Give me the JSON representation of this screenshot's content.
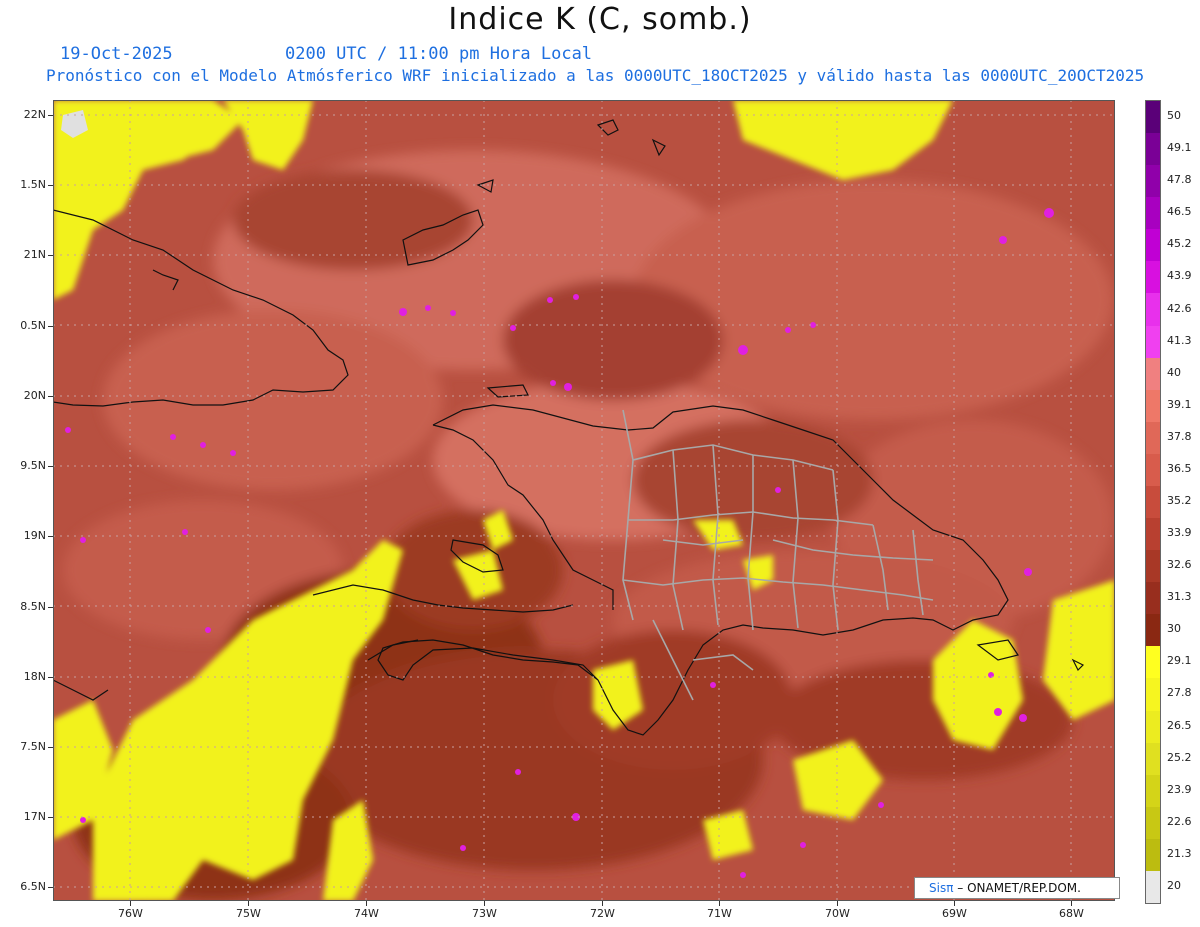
{
  "header": {
    "title": "Indice K (C, somb.)",
    "date": "19-Oct-2025",
    "time": "0200 UTC / 11:00 pm Hora Local",
    "forecast": "Pronóstico con el Modelo Atmósferico WRF inicializado a las 0000UTC_18OCT2025 y válido hasta las  0000UTC_20OCT2025"
  },
  "axes": {
    "lat_labels": [
      "22N",
      "1.5N",
      "21N",
      "0.5N",
      "20N",
      "9.5N",
      "19N",
      "8.5N",
      "18N",
      "7.5N",
      "17N",
      "6.5N"
    ],
    "lon_labels": [
      "76W",
      "75W",
      "74W",
      "73W",
      "72W",
      "71W",
      "70W",
      "69W",
      "68W"
    ]
  },
  "colorbar": {
    "labels": [
      "50",
      "49.1",
      "47.8",
      "46.5",
      "45.2",
      "43.9",
      "42.6",
      "41.3",
      "40",
      "39.1",
      "37.8",
      "36.5",
      "35.2",
      "33.9",
      "32.6",
      "31.3",
      "30",
      "29.1",
      "27.8",
      "26.5",
      "25.2",
      "23.9",
      "22.6",
      "21.3",
      "20"
    ],
    "colors": [
      "#5a0078",
      "#7a0096",
      "#9000aa",
      "#a800c0",
      "#c000d4",
      "#d810e0",
      "#e830ec",
      "#f040f0",
      "#f08080",
      "#ee7868",
      "#e06858",
      "#d85c4c",
      "#c84c3c",
      "#b84030",
      "#a83826",
      "#982e1e",
      "#8a2812",
      "#ffff20",
      "#f6f520",
      "#ecec20",
      "#e0e020",
      "#d4d418",
      "#c8c814",
      "#bcbc10",
      "#e8e8e8"
    ]
  },
  "credit": {
    "sis": "Sisπ",
    "org": " – ONAMET/REP.DOM."
  }
}
